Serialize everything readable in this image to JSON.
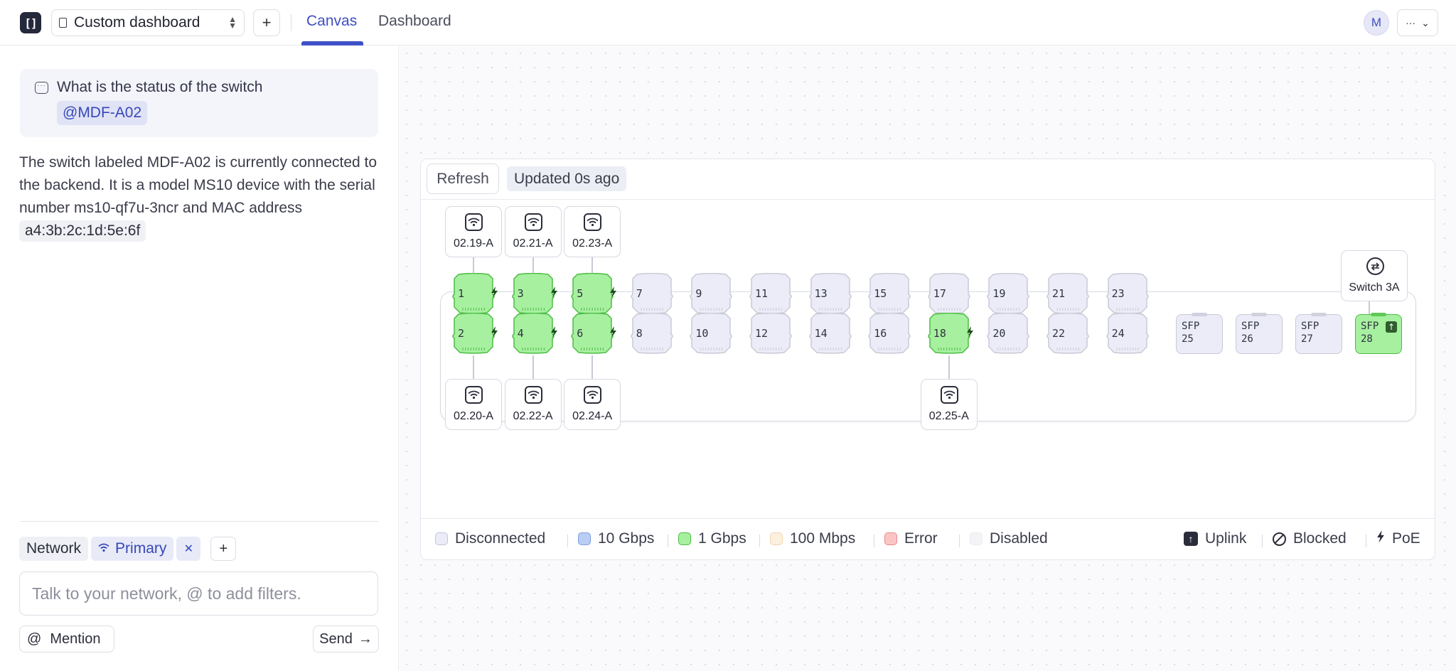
{
  "app": {
    "logo_glyph": "[]",
    "document_name": "Custom dashboard",
    "add_label": "+",
    "tabs": [
      {
        "label": "Canvas",
        "active": true
      },
      {
        "label": "Dashboard",
        "active": false
      }
    ],
    "avatar_initial": "M",
    "more_label": "···"
  },
  "chat": {
    "query_text": "What is the status of the switch",
    "query_mention": "@MDF-A02",
    "answer_text": "The switch labeled MDF-A02 is currently connected to the backend. It is a model MS10 device with the serial number ms10-qf7u-3ncr and MAC address ",
    "answer_mac": "a4:3b:2c:1d:5e:6f",
    "filters": {
      "network_label": "Network",
      "primary_label": "Primary",
      "remove_label": "✕",
      "add_label": "+"
    },
    "input_placeholder": "Talk to your network, @ to add filters.",
    "input_value": "",
    "mention_label": "Mention",
    "mention_at": "@",
    "send_label": "Send",
    "send_arrow": "→"
  },
  "widget": {
    "refresh_label": "Refresh",
    "updated_label": "Updated 0s ago",
    "ports_top": [
      {
        "label": "1",
        "status": "1gbps",
        "poe": true
      },
      {
        "label": "3",
        "status": "1gbps",
        "poe": true
      },
      {
        "label": "5",
        "status": "1gbps",
        "poe": true
      },
      {
        "label": "7",
        "status": "disconnected",
        "poe": false
      },
      {
        "label": "9",
        "status": "disconnected",
        "poe": false
      },
      {
        "label": "11",
        "status": "disconnected",
        "poe": false
      },
      {
        "label": "13",
        "status": "disconnected",
        "poe": false
      },
      {
        "label": "15",
        "status": "disconnected",
        "poe": false
      },
      {
        "label": "17",
        "status": "disconnected",
        "poe": false
      },
      {
        "label": "19",
        "status": "disconnected",
        "poe": false
      },
      {
        "label": "21",
        "status": "disconnected",
        "poe": false
      },
      {
        "label": "23",
        "status": "disconnected",
        "poe": false
      }
    ],
    "ports_bottom": [
      {
        "label": "2",
        "status": "1gbps",
        "poe": true
      },
      {
        "label": "4",
        "status": "1gbps",
        "poe": true
      },
      {
        "label": "6",
        "status": "1gbps",
        "poe": true
      },
      {
        "label": "8",
        "status": "disconnected",
        "poe": false
      },
      {
        "label": "10",
        "status": "disconnected",
        "poe": false
      },
      {
        "label": "12",
        "status": "disconnected",
        "poe": false
      },
      {
        "label": "14",
        "status": "disconnected",
        "poe": false
      },
      {
        "label": "16",
        "status": "disconnected",
        "poe": false
      },
      {
        "label": "18",
        "status": "1gbps",
        "poe": true
      },
      {
        "label": "20",
        "status": "disconnected",
        "poe": false
      },
      {
        "label": "22",
        "status": "disconnected",
        "poe": false
      },
      {
        "label": "24",
        "status": "disconnected",
        "poe": false
      }
    ],
    "sfp_ports": [
      {
        "line1": "SFP",
        "line2": "25",
        "status": "disconnected",
        "uplink": false
      },
      {
        "line1": "SFP",
        "line2": "26",
        "status": "disconnected",
        "uplink": false
      },
      {
        "line1": "SFP",
        "line2": "27",
        "status": "disconnected",
        "uplink": false
      },
      {
        "line1": "SFP",
        "line2": "28",
        "status": "1gbps",
        "uplink": true
      }
    ],
    "aps_top": [
      {
        "label": "02.19-A",
        "port": "1"
      },
      {
        "label": "02.21-A",
        "port": "3"
      },
      {
        "label": "02.23-A",
        "port": "5"
      }
    ],
    "aps_bottom": [
      {
        "label": "02.20-A",
        "port": "2"
      },
      {
        "label": "02.22-A",
        "port": "4"
      },
      {
        "label": "02.24-A",
        "port": "6"
      },
      {
        "label": "02.25-A",
        "port": "18"
      }
    ],
    "uplink_device": {
      "label": "Switch 3A",
      "port": "SFP 28"
    },
    "legend_left": [
      {
        "label": "Disconnected",
        "fill": "#ebecf7",
        "border": "#c2c5dc"
      },
      {
        "label": "10 Gbps",
        "fill": "#b9cdf5",
        "border": "#7f9fe0"
      },
      {
        "label": "1 Gbps",
        "fill": "#a7f0a0",
        "border": "#4ebc45"
      },
      {
        "label": "100 Mbps",
        "fill": "#fdf0df",
        "border": "#f1d6b0"
      },
      {
        "label": "Error",
        "fill": "#fbc5c5",
        "border": "#e88989"
      },
      {
        "label": "Disabled",
        "fill": "#f4f4f7",
        "border": "#ebebf0"
      }
    ],
    "legend_right": [
      {
        "label": "Uplink",
        "icon": "uplink-icon"
      },
      {
        "label": "Blocked",
        "icon": "blocked-icon"
      },
      {
        "label": "PoE",
        "icon": "poe-bolt-icon"
      }
    ],
    "colors": {
      "accent": "#3f51c8",
      "port_1gbps_fill": "#a7f0a0",
      "port_1gbps_stroke": "#4ebc45",
      "port_disconnected_fill": "#ebecf7",
      "port_disconnected_stroke": "#c8cad6"
    }
  }
}
